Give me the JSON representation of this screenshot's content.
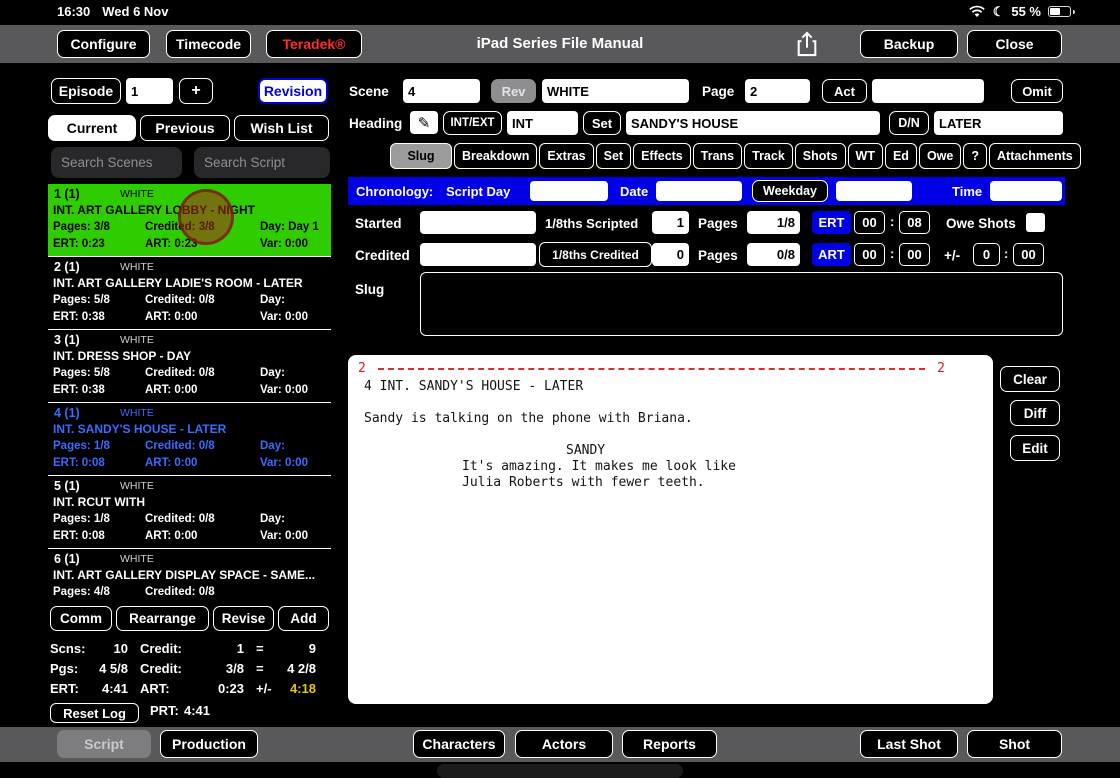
{
  "status_bar": {
    "time": "16:30",
    "date": "Wed 6 Nov",
    "battery": "55 %"
  },
  "top_toolbar": {
    "configure": "Configure",
    "timecode": "Timecode",
    "teradek": "Teradek®",
    "title": "iPad Series File Manual",
    "backup": "Backup",
    "close": "Close"
  },
  "left_panel": {
    "episode_label": "Episode",
    "episode_number": "1",
    "add_label": "+",
    "revision_label": "Revision",
    "view_tabs": {
      "current": "Current",
      "previous": "Previous",
      "wish_list": "Wish List"
    },
    "search_scenes_placeholder": "Search Scenes",
    "search_script_placeholder": "Search Script",
    "scene_labels": {
      "pages": "Pages:",
      "credited": "Credited:",
      "day": "Day:",
      "ert": "ERT:",
      "art": "ART:",
      "var": "Var:"
    },
    "scenes": [
      {
        "number": "1 (1)",
        "color": "WHITE",
        "heading": "INT. ART GALLERY LOBBY - NIGHT",
        "pages": "3/8",
        "credited": "3/8",
        "day": "Day 1",
        "ert": "0:23",
        "art": "0:23",
        "var": "0:00"
      },
      {
        "number": "2 (1)",
        "color": "WHITE",
        "heading": "INT. ART GALLERY LADIE'S ROOM - LATER",
        "pages": "5/8",
        "credited": "0/8",
        "day": "",
        "ert": "0:38",
        "art": "0:00",
        "var": "0:00"
      },
      {
        "number": "3 (1)",
        "color": "WHITE",
        "heading": "INT. DRESS SHOP - DAY",
        "pages": "5/8",
        "credited": "0/8",
        "day": "",
        "ert": "0:38",
        "art": "0:00",
        "var": "0:00"
      },
      {
        "number": "4 (1)",
        "color": "WHITE",
        "heading": "INT. SANDY'S HOUSE - LATER",
        "pages": "1/8",
        "credited": "0/8",
        "day": "",
        "ert": "0:08",
        "art": "0:00",
        "var": "0:00"
      },
      {
        "number": "5 (1)",
        "color": "WHITE",
        "heading": "INT. RCUT WITH",
        "pages": "1/8",
        "credited": "0/8",
        "day": "",
        "ert": "0:08",
        "art": "0:00",
        "var": "0:00"
      },
      {
        "number": "6 (1)",
        "color": "WHITE",
        "heading": "INT. ART GALLERY DISPLAY SPACE - SAME...",
        "pages": "4/8",
        "credited": "0/8"
      }
    ],
    "actions": {
      "comm": "Comm",
      "rearrange": "Rearrange",
      "revise": "Revise",
      "add": "Add"
    },
    "totals": {
      "rows": [
        {
          "l1": "Scns:",
          "v1": "10",
          "l2": "Credit:",
          "v2": "1",
          "op": "=",
          "v3": "9"
        },
        {
          "l1": "Pgs:",
          "v1": "4 5/8",
          "l2": "Credit:",
          "v2": "3/8",
          "op": "=",
          "v3": "4 2/8"
        },
        {
          "l1": "ERT:",
          "v1": "4:41",
          "l2": "ART:",
          "v2": "0:23",
          "op": "+/-",
          "v3": "4:18"
        }
      ],
      "reset_log": "Reset Log",
      "prt_label": "PRT:",
      "prt_value": "4:41"
    }
  },
  "detail": {
    "scene_label": "Scene",
    "scene_number": "4",
    "rev_label": "Rev",
    "revision_color": "WHITE",
    "page_label": "Page",
    "page_number": "2",
    "act_label": "Act",
    "omit_label": "Omit",
    "heading_label": "Heading",
    "intext_label": "INT/EXT",
    "intext_value": "INT",
    "set_label": "Set",
    "set_value": "SANDY'S HOUSE",
    "dn_label": "D/N",
    "dn_value": "LATER",
    "tabs": [
      "Slug",
      "Breakdown",
      "Extras",
      "Set",
      "Effects",
      "Trans",
      "Track",
      "Shots",
      "WT",
      "Ed",
      "Owe",
      "?",
      "Attachments"
    ],
    "chronology": {
      "label": "Chronology:",
      "script_day": "Script Day",
      "date": "Date",
      "weekday": "Weekday",
      "time": "Time"
    },
    "started_label": "Started",
    "scripted_label": "1/8ths Scripted",
    "scripted_value": "1",
    "pages_label": "Pages",
    "pages_scripted": "1/8",
    "ert_label": "ERT",
    "ert_h": "00",
    "ert_m": "08",
    "owe_shots_label": "Owe Shots",
    "credited_label": "Credited",
    "credited_btn_label": "1/8ths Credited",
    "credited_value": "0",
    "pages_credited": "0/8",
    "art_label": "ART",
    "art_h": "00",
    "art_m": "00",
    "plus_minus_label": "+/-",
    "pm_h": "0",
    "pm_m": "00",
    "slug_label": "Slug"
  },
  "script_preview": {
    "page_left": "2",
    "page_right": "2",
    "scene_heading": "4 INT. SANDY'S HOUSE - LATER",
    "action": "Sandy is talking on the phone with Briana.",
    "character": "SANDY",
    "dialogue_1": "It's amazing. It makes me look like",
    "dialogue_2": "Julia Roberts with fewer teeth.",
    "clear": "Clear",
    "diff": "Diff",
    "edit": "Edit"
  },
  "bottom_toolbar": {
    "script": "Script",
    "production": "Production",
    "characters": "Characters",
    "actors": "Actors",
    "reports": "Reports",
    "last_shot": "Last Shot",
    "shot": "Shot"
  }
}
